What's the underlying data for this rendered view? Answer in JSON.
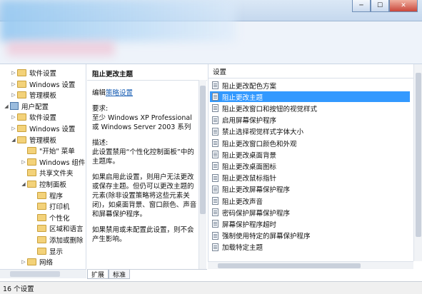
{
  "window": {
    "minimize": "─",
    "maximize": "☐",
    "close": "✕"
  },
  "tree": {
    "items": [
      {
        "label": "软件设置",
        "indent": 1
      },
      {
        "label": "Windows 设置",
        "indent": 1
      },
      {
        "label": "管理模板",
        "indent": 1
      },
      {
        "label": "用户配置",
        "indent": 0
      },
      {
        "label": "软件设置",
        "indent": 1
      },
      {
        "label": "Windows 设置",
        "indent": 1
      },
      {
        "label": "管理模板",
        "indent": 1
      },
      {
        "label": "\"开始\" 菜单",
        "indent": 2
      },
      {
        "label": "Windows 组件",
        "indent": 2
      },
      {
        "label": "共享文件夹",
        "indent": 2
      },
      {
        "label": "控制面板",
        "indent": 2
      },
      {
        "label": "程序",
        "indent": 3
      },
      {
        "label": "打印机",
        "indent": 3
      },
      {
        "label": "个性化",
        "indent": 3
      },
      {
        "label": "区域和语言",
        "indent": 3
      },
      {
        "label": "添加或删除",
        "indent": 3
      },
      {
        "label": "显示",
        "indent": 3
      },
      {
        "label": "网络",
        "indent": 2
      }
    ]
  },
  "description": {
    "heading": "阻止更改主题",
    "edit_prefix": "编辑",
    "edit_link": "策略设置",
    "requirements_label": "要求:",
    "requirements_text": "至少 Windows XP Professional 或 Windows Server 2003 系列",
    "desc_label": "描述:",
    "desc_text": "此设置禁用“个性化控制面板”中的主题库。",
    "paragraph1": "如果启用此设置，则用户无法更改或保存主题。但仍可以更改主题的元素(除非设置策略将这些元素关闭)，如桌面背景、窗口颜色、声音和屏幕保护程序。",
    "paragraph2": "如果禁用或未配置此设置，则不会产生影响。"
  },
  "tabs": {
    "extended": "扩展",
    "standard": "标准"
  },
  "list": {
    "header": "设置",
    "items": [
      "阻止更改配色方案",
      "阻止更改主题",
      "阻止更改窗口和按钮的视觉样式",
      "启用屏幕保护程序",
      "禁止选择视觉样式字体大小",
      "阻止更改窗口颜色和外观",
      "阻止更改桌面背景",
      "阻止更改桌面图标",
      "阻止更改鼠标指针",
      "阻止更改屏幕保护程序",
      "阻止更改声音",
      "密码保护屏幕保护程序",
      "屏幕保护程序超时",
      "强制使用特定的屏幕保护程序",
      "加载特定主题"
    ],
    "selected_index": 1
  },
  "status": {
    "text": "16 个设置"
  }
}
